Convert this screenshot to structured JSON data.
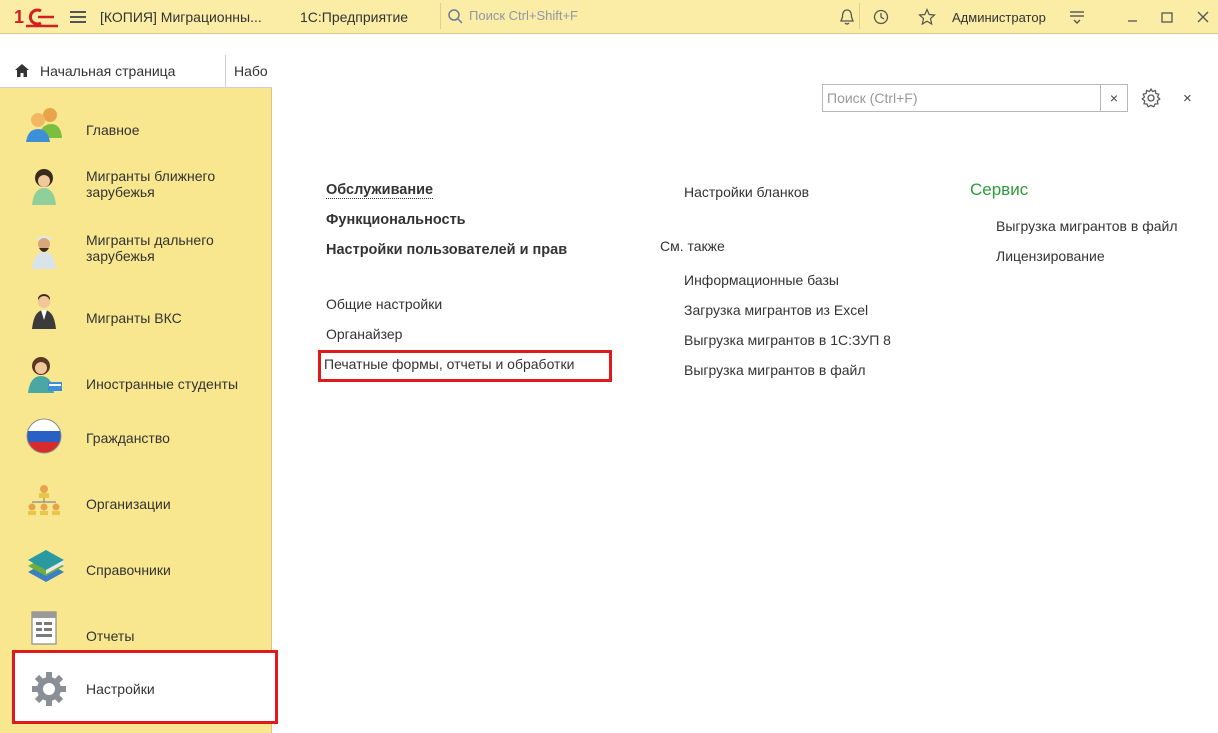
{
  "titlebar": {
    "window_title": "[КОПИЯ] Миграционны...",
    "app_name": "1С:Предприятие",
    "search_placeholder": "Поиск Ctrl+Shift+F",
    "user": "Администратор"
  },
  "tabs": {
    "home": "Начальная страница",
    "second_cut": "Набо"
  },
  "sidebar": {
    "items": [
      {
        "label": "Главное",
        "icon": "people-icon"
      },
      {
        "label": "Мигранты ближнего зарубежья",
        "icon": "migrant-near-icon"
      },
      {
        "label": "Мигранты дальнего зарубежья",
        "icon": "migrant-far-icon"
      },
      {
        "label": "Мигранты ВКС",
        "icon": "migrant-vks-icon"
      },
      {
        "label": "Иностранные студенты",
        "icon": "student-icon"
      },
      {
        "label": "Гражданство",
        "icon": "flag-icon"
      },
      {
        "label": "Организации",
        "icon": "org-chart-icon"
      },
      {
        "label": "Справочники",
        "icon": "books-icon"
      },
      {
        "label": "Отчеты",
        "icon": "report-icon"
      },
      {
        "label": "Настройки",
        "icon": "gear-icon"
      }
    ],
    "active_item": "Настройки"
  },
  "panel": {
    "search_placeholder": "Поиск (Ctrl+F)",
    "clear_label": "×",
    "close_label": "×",
    "col1_bold": [
      "Обслуживание",
      "Функциональность",
      "Настройки пользователей и прав"
    ],
    "col1_links": [
      "Общие настройки",
      "Органайзер",
      "Печатные формы, отчеты и обработки"
    ],
    "col2_top": "Настройки бланков",
    "col2_see_also": "См. также",
    "col2_links": [
      "Информационные базы",
      "Загрузка мигрантов из Excel",
      "Выгрузка мигрантов в 1С:ЗУП 8",
      "Выгрузка мигрантов в файл"
    ],
    "col3_title": "Сервис",
    "col3_links": [
      "Выгрузка мигрантов в файл",
      "Лицензирование"
    ]
  },
  "colors": {
    "sidebar_bg": "#f8e78e",
    "titlebar_bg": "#fbeda5",
    "highlight": "#e01a1a",
    "section_green": "#2e9a3d"
  }
}
